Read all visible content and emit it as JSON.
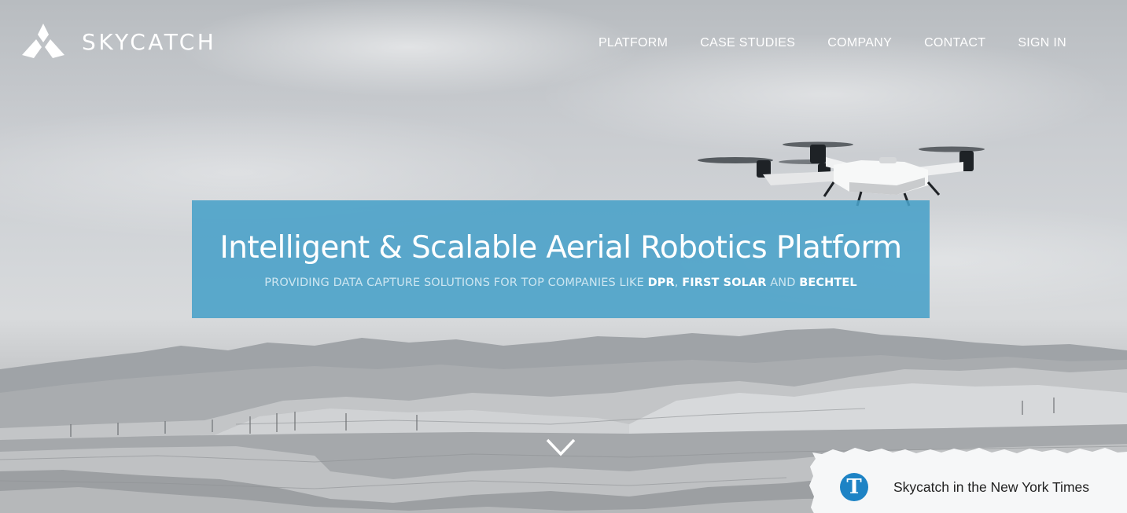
{
  "brand": {
    "name": "SKYCATCH"
  },
  "nav": {
    "items": [
      {
        "label": "PLATFORM"
      },
      {
        "label": "CASE STUDIES"
      },
      {
        "label": "COMPANY"
      },
      {
        "label": "CONTACT"
      },
      {
        "label": "SIGN IN"
      }
    ]
  },
  "hero": {
    "title": "Intelligent & Scalable Aerial Robotics Platform",
    "subtitle_prefix": "PROVIDING DATA CAPTURE SOLUTIONS FOR TOP COMPANIES LIKE ",
    "company_1": "DPR",
    "separator_1": ", ",
    "company_2": "FIRST SOLAR",
    "separator_2": " AND ",
    "company_3": "BECHTEL"
  },
  "press": {
    "icon": "nyt-logo-icon",
    "icon_glyph": "T",
    "label": "Skycatch in the New York Times"
  },
  "scroll": {
    "icon": "chevron-down-icon"
  },
  "colors": {
    "banner": "#48a0c8",
    "nyt_blue": "#1d83c5",
    "nav_text": "#ffffff"
  }
}
